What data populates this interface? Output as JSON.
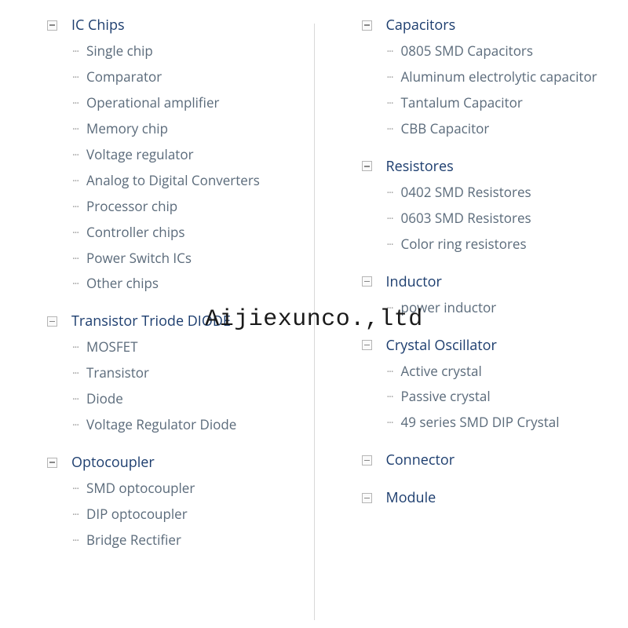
{
  "watermark": "Aijiexunco.,ltd",
  "left_column": [
    {
      "title": "IC Chips",
      "items": [
        "Single chip",
        "Comparator",
        "Operational amplifier",
        "Memory chip",
        "Voltage regulator",
        "Analog to Digital Converters",
        "Processor chip",
        "Controller chips",
        "Power Switch ICs",
        "Other chips"
      ]
    },
    {
      "title": "Transistor Triode DIODE",
      "items": [
        "MOSFET",
        "Transistor",
        "Diode",
        "Voltage Regulator Diode"
      ]
    },
    {
      "title": "Optocoupler",
      "items": [
        "SMD optocoupler",
        "DIP optocoupler",
        "Bridge Rectifier"
      ]
    }
  ],
  "right_column": [
    {
      "title": "Capacitors",
      "items": [
        "0805 SMD Capacitors",
        "Aluminum electrolytic capacitor",
        "Tantalum Capacitor",
        "CBB Capacitor"
      ]
    },
    {
      "title": "Resistores",
      "items": [
        "0402 SMD Resistores",
        "0603 SMD Resistores",
        "Color ring resistores"
      ]
    },
    {
      "title": "Inductor",
      "items": [
        "power inductor"
      ]
    },
    {
      "title": "Crystal Oscillator",
      "items": [
        "Active crystal",
        "Passive crystal",
        "49 series SMD DIP Crystal"
      ]
    },
    {
      "title": "Connector",
      "items": []
    },
    {
      "title": "Module",
      "items": []
    }
  ]
}
